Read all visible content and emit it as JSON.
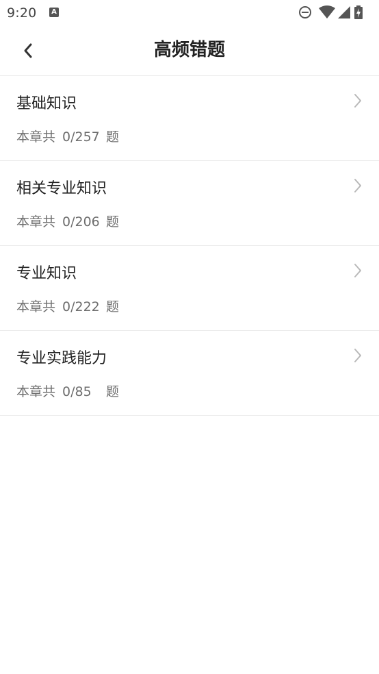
{
  "status_bar": {
    "time": "9:20",
    "notification_icon": "a-icon",
    "icons": [
      "do-not-disturb-icon",
      "wifi-icon",
      "signal-icon",
      "battery-charging-icon"
    ]
  },
  "header": {
    "title": "高频错题",
    "back_icon": "chevron-left-icon"
  },
  "chapters": [
    {
      "title": "基础知识",
      "prefix": "本章共",
      "count": "0/257",
      "suffix": "题"
    },
    {
      "title": "相关专业知识",
      "prefix": "本章共",
      "count": "0/206",
      "suffix": "题"
    },
    {
      "title": "专业知识",
      "prefix": "本章共",
      "count": "0/222",
      "suffix": "题"
    },
    {
      "title": "专业实践能力",
      "prefix": "本章共",
      "count": "0/85",
      "suffix": "题"
    }
  ],
  "colors": {
    "text_primary": "#222222",
    "text_secondary": "#6e6e6e",
    "divider": "#ececec",
    "chevron": "#b8b8b8"
  }
}
